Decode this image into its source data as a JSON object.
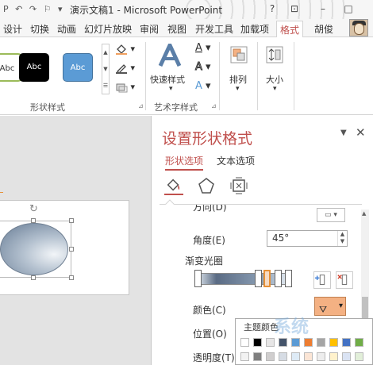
{
  "titlebar": {
    "qat": [
      "P",
      "↶",
      "↷",
      "⚐",
      "▾"
    ],
    "title": "演示文稿1 - Microsoft PowerPoint",
    "controls": [
      "?",
      "⊡",
      "–",
      "□"
    ]
  },
  "tabs": [
    "设计",
    "切换",
    "动画",
    "幻灯片放映",
    "审阅",
    "视图",
    "开发工具",
    "加载项",
    "格式"
  ],
  "active_tab": "格式",
  "user_name": "胡俊",
  "ribbon": {
    "shape_samples": [
      "Abc",
      "Abc",
      "Abc"
    ],
    "shape_styles_group": "形状样式",
    "quick_styles": "快速样式",
    "art_text_group": "艺术字样式",
    "arrange": "排列",
    "size": "大小",
    "font_a": "A"
  },
  "pane": {
    "title": "设置形状格式",
    "tabs": [
      "形状选项",
      "文本选项"
    ],
    "direction_label": "方向(D)",
    "angle_label": "角度(E)",
    "angle_value": "45°",
    "gradient_stops_label": "渐变光圈",
    "color_label": "颜色(C)",
    "position_label": "位置(O)",
    "transparency_label": "透明度(T)"
  },
  "color_dropdown": {
    "title": "主题颜色",
    "swatch_colors": [
      "#ffffff",
      "#000000",
      "#e7e6e6",
      "#44546a",
      "#5b9bd5",
      "#ed7d31",
      "#a5a5a5",
      "#ffc000",
      "#4472c4",
      "#70ad47"
    ],
    "second_row": [
      "#f2f2f2",
      "#7f7f7f",
      "#d0cece",
      "#d6dce4",
      "#deebf6",
      "#fbe5d5",
      "#ededed",
      "#fff2cc",
      "#dae3f3",
      "#e2efd9"
    ]
  },
  "accent_color": "#c0504d"
}
